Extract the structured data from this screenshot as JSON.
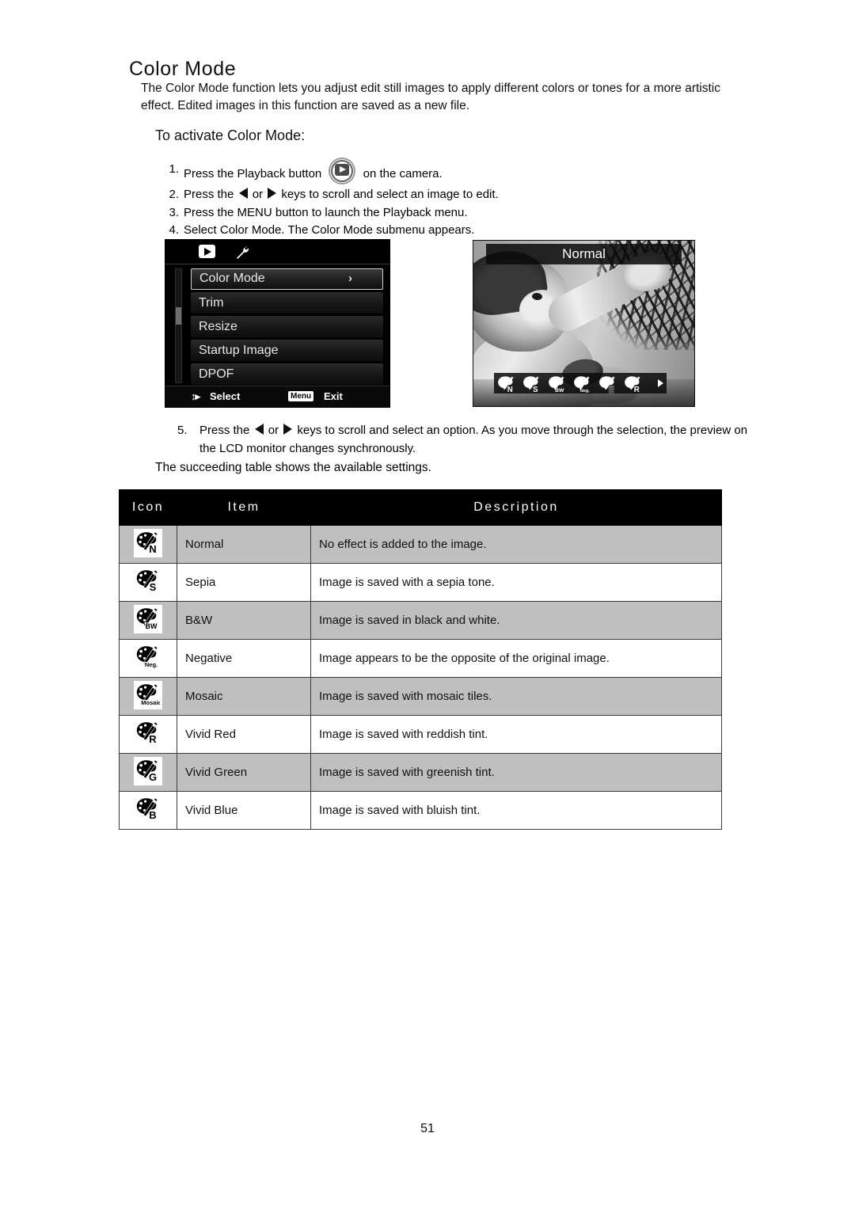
{
  "page": {
    "title": "Color Mode",
    "intro": "The Color Mode function lets you adjust edit still images to apply different colors or tones for a more artistic effect. Edited images in this function are saved as a new file.",
    "subhead": "To activate Color Mode:",
    "page_number": "51",
    "succeeding_note": "The succeeding table shows the available settings."
  },
  "steps": {
    "s1_num": "1.",
    "s1_a": "Press the Playback button",
    "s1_b": "on the camera.",
    "s2_num": "2.",
    "s2_a": "Press the",
    "s2_or": "or",
    "s2_b": "keys to scroll and select an image to edit.",
    "s3_num": "3.",
    "s3_text": "Press the MENU button to launch the Playback menu.",
    "s4_num": "4.",
    "s4_text": "Select Color Mode. The Color Mode submenu appears.",
    "s5_num": "5.",
    "s5_a": "Press the",
    "s5_or": "or",
    "s5_b": "keys to scroll and select an option. As you move through the selection, the preview on the LCD monitor changes synchronously."
  },
  "camera_menu": {
    "tabs": [
      "playback-icon",
      "wrench-icon"
    ],
    "items": [
      {
        "label": "Color Mode",
        "selected": true,
        "chevron": "›"
      },
      {
        "label": "Trim",
        "selected": false
      },
      {
        "label": "Resize",
        "selected": false
      },
      {
        "label": "Startup Image",
        "selected": false
      },
      {
        "label": "DPOF",
        "selected": false
      }
    ],
    "footer": {
      "updown_icon": "↕▸",
      "select_label": "Select",
      "menu_chip": "Menu",
      "exit_label": "Exit"
    }
  },
  "lcd_preview": {
    "mode_title": "Normal",
    "option_icons": [
      "N",
      "S",
      "BW",
      "Neg.",
      "Mosaic",
      "R"
    ],
    "more_arrow": "▸"
  },
  "table": {
    "headers": [
      "Icon",
      "Item",
      "Description"
    ],
    "rows": [
      {
        "icon": "N",
        "item": "Normal",
        "description": "No effect is added to the image."
      },
      {
        "icon": "S",
        "item": "Sepia",
        "description": "Image is saved with a sepia tone."
      },
      {
        "icon": "BW",
        "item": "B&W",
        "description": "Image is saved in black and white."
      },
      {
        "icon": "Neg.",
        "item": "Negative",
        "description": "Image appears to be the opposite of the original image."
      },
      {
        "icon": "Mosaic",
        "item": "Mosaic",
        "description": "Image is saved with mosaic tiles."
      },
      {
        "icon": "R",
        "item": "Vivid Red",
        "description": "Image is saved with reddish tint."
      },
      {
        "icon": "G",
        "item": "Vivid Green",
        "description": "Image is saved with greenish tint."
      },
      {
        "icon": "B",
        "item": "Vivid Blue",
        "description": "Image is saved with bluish tint."
      }
    ]
  },
  "colors": {
    "shade_row": "#bfbfbf",
    "header_bg": "#000000",
    "text": "#111111"
  }
}
